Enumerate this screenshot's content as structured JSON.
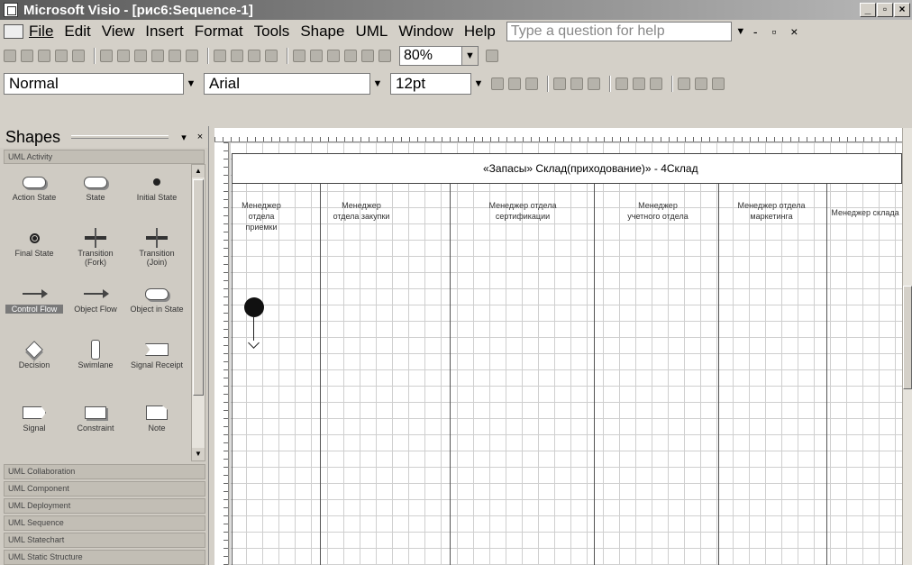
{
  "window": {
    "title": "Microsoft Visio - [рис6:Sequence-1]",
    "controls": [
      "_",
      "▫",
      "×"
    ]
  },
  "menu": {
    "items": [
      {
        "label": "File"
      },
      {
        "label": "Edit"
      },
      {
        "label": "View"
      },
      {
        "label": "Insert"
      },
      {
        "label": "Format"
      },
      {
        "label": "Tools"
      },
      {
        "label": "Shape"
      },
      {
        "label": "UML"
      },
      {
        "label": "Window"
      },
      {
        "label": "Help"
      }
    ],
    "help_placeholder": "Type a question for help"
  },
  "toolbar": {
    "zoom": "80%"
  },
  "format_toolbar": {
    "style": "Normal",
    "font": "Arial",
    "size": "12pt"
  },
  "shapes": {
    "title": "Shapes",
    "active_stencil": "UML Activity",
    "items": [
      {
        "label": "Action State",
        "icon": "action-state-icon"
      },
      {
        "label": "State",
        "icon": "state-icon"
      },
      {
        "label": "Initial State",
        "icon": "initial-state-icon"
      },
      {
        "label": "Final State",
        "icon": "final-state-icon"
      },
      {
        "label": "Transition (Fork)",
        "icon": "fork-icon"
      },
      {
        "label": "Transition (Join)",
        "icon": "join-icon"
      },
      {
        "label": "Control Flow",
        "icon": "control-flow-icon"
      },
      {
        "label": "Object Flow",
        "icon": "object-flow-icon"
      },
      {
        "label": "Object in State",
        "icon": "object-in-state-icon"
      },
      {
        "label": "Decision",
        "icon": "decision-icon"
      },
      {
        "label": "Swimlane",
        "icon": "swimlane-icon"
      },
      {
        "label": "Signal Receipt",
        "icon": "signal-receipt-icon"
      },
      {
        "label": "Signal",
        "icon": "signal-icon"
      },
      {
        "label": "Constraint",
        "icon": "constraint-icon"
      },
      {
        "label": "Note",
        "icon": "note-icon"
      }
    ],
    "stencils": [
      "UML Collaboration",
      "UML Component",
      "UML Deployment",
      "UML Sequence",
      "UML Statechart",
      "UML Static Structure"
    ]
  },
  "diagram": {
    "header": "«Запасы» Склад(приходование)» - 4Склад",
    "lanes": [
      "Менеджер отдела приемки",
      "Менеджер отдела закупки",
      "Менеджер отдела сертификации",
      "Менеджер учетного отдела",
      "Менеджер отдела маркетинга",
      "Менеджер склада"
    ]
  }
}
